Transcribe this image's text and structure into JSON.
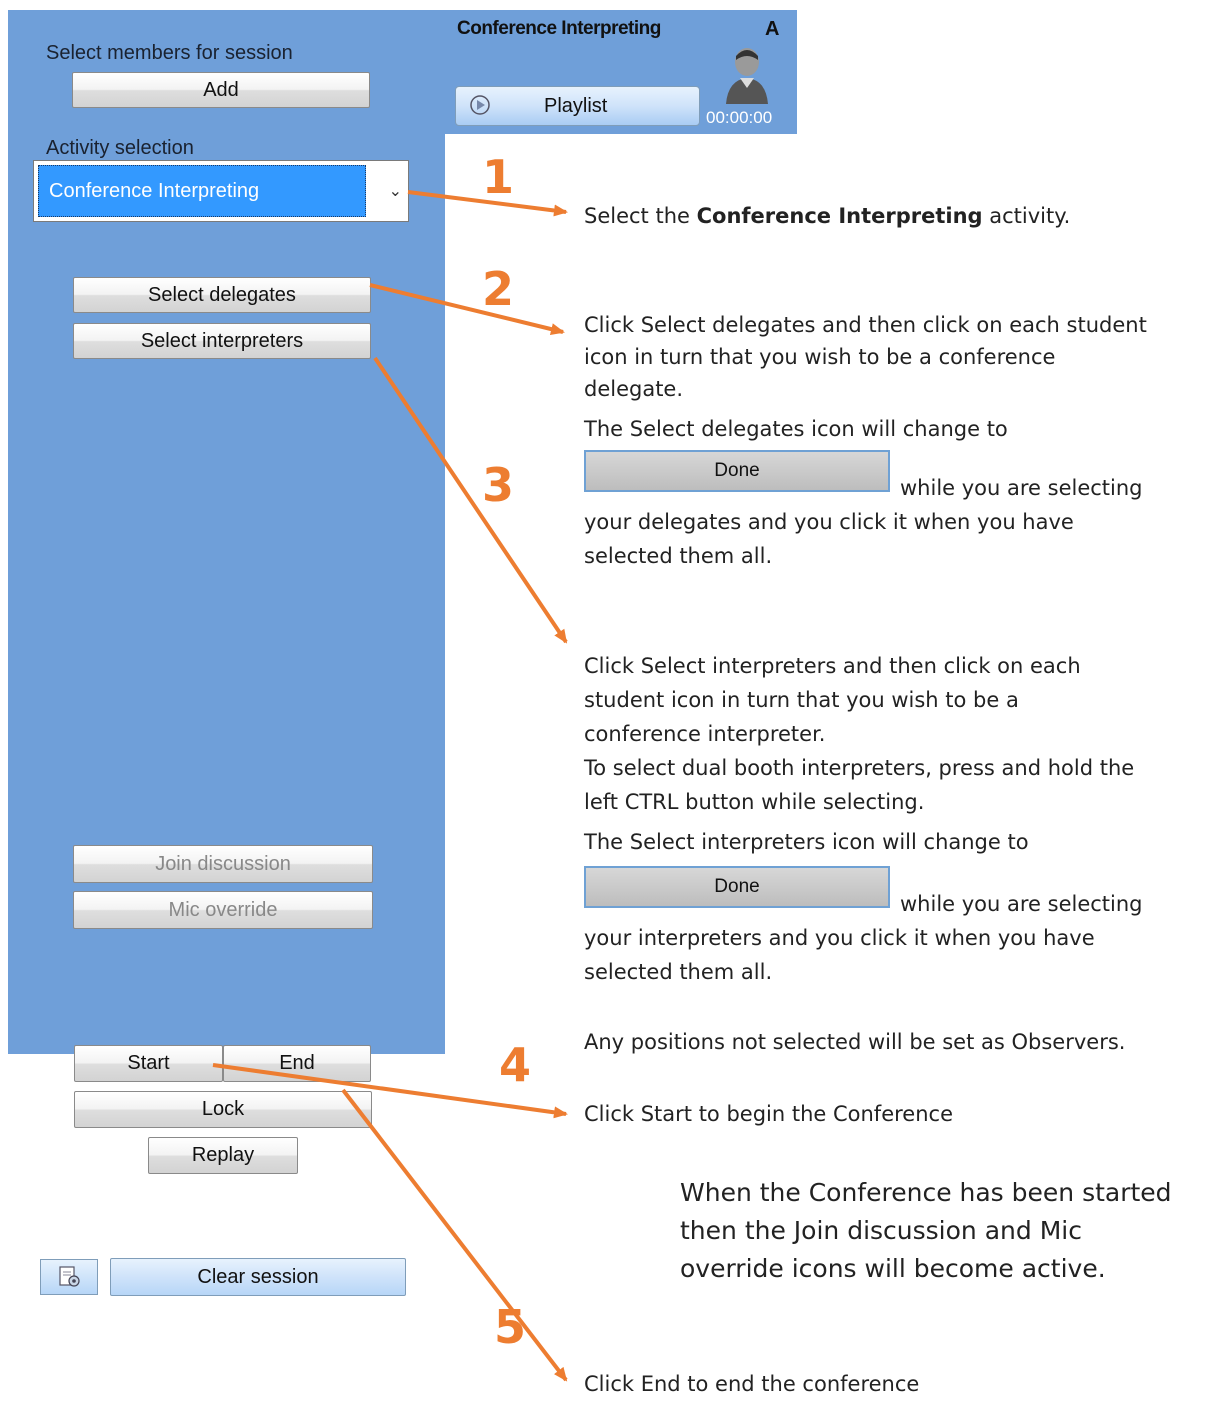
{
  "panel": {
    "members_label": "Select members for session",
    "add_label": "Add",
    "activity_label": "Activity selection",
    "activity_value": "Conference Interpreting",
    "select_delegates": "Select delegates",
    "select_interpreters": "Select interpreters",
    "join_discussion": "Join discussion",
    "mic_override": "Mic override",
    "start": "Start",
    "end": "End",
    "lock": "Lock",
    "replay": "Replay",
    "clear_session": "Clear session"
  },
  "topbar": {
    "title": "Conference Interpreting",
    "position_letter": "A",
    "playlist_label": "Playlist",
    "timer": "00:00:00"
  },
  "steps": {
    "n1": "1",
    "n2": "2",
    "n3": "3",
    "n4": "4",
    "n5": "5"
  },
  "instructions": {
    "s1_pre": "Select the ",
    "s1_bold": "Conference Interpreting",
    "s1_post": " activity.",
    "s2_l1": "Click Select delegates and then click on each student",
    "s2_l2": "icon in turn that you wish to be a conference",
    "s2_l3": "delegate.",
    "s2_l4": "The Select delegates icon will change to",
    "s2_l5": "while you are selecting",
    "s2_l6": "your delegates and you click it when you have",
    "s2_l7": "selected them all.",
    "s3_l1": "Click Select interpreters and then click on each",
    "s3_l2": "student icon in turn that you wish to be a",
    "s3_l3": "conference interpreter.",
    "s3_l4": "To select dual booth interpreters, press and hold the",
    "s3_l5": "left CTRL button while selecting.",
    "s3_l6": "The Select interpreters icon will change to",
    "s3_l7": "while you are selecting",
    "s3_l8": "your interpreters and you click it when you have",
    "s3_l9": "selected them all.",
    "observers": "Any positions not selected will be set as Observers.",
    "s4": "Click Start to begin the Conference",
    "active_l1": "When the Conference has been started",
    "active_l2": "then the Join discussion and Mic",
    "active_l3": "override icons will become active.",
    "s5": "Click End to end the conference",
    "done_label": "Done"
  },
  "colors": {
    "panel_bg": "#6f9fd9",
    "arrow": "#ed7d31",
    "highlight": "#3399ff"
  }
}
